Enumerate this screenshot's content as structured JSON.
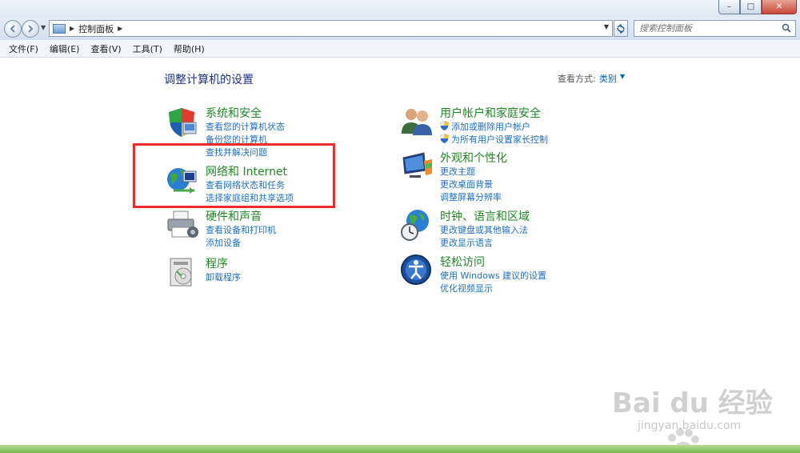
{
  "window": {
    "buttons": {
      "minimize": "–",
      "maximize": "□",
      "close": "✕"
    }
  },
  "address": {
    "path": "控制面板",
    "search_placeholder": "搜索控制面板"
  },
  "menu": [
    "文件(F)",
    "编辑(E)",
    "查看(V)",
    "工具(T)",
    "帮助(H)"
  ],
  "page": {
    "title": "调整计算机的设置",
    "view_by_label": "查看方式:",
    "view_by_value": "类别"
  },
  "categories": [
    {
      "title": "系统和安全",
      "icon": "shield-security-icon",
      "links": [
        "查看您的计算机状态",
        "备份您的计算机",
        "查找并解决问题"
      ]
    },
    {
      "title": "网络和 Internet",
      "icon": "network-globe-icon",
      "links": [
        "查看网络状态和任务",
        "选择家庭组和共享选项"
      ]
    },
    {
      "title": "硬件和声音",
      "icon": "printer-icon",
      "links": [
        "查看设备和打印机",
        "添加设备"
      ]
    },
    {
      "title": "程序",
      "icon": "programs-icon",
      "links": [
        "卸载程序"
      ]
    },
    {
      "title": "用户帐户和家庭安全",
      "icon": "users-icon",
      "links": [
        "添加或删除用户帐户",
        "为所有用户设置家长控制"
      ]
    },
    {
      "title": "外观和个性化",
      "icon": "display-icon",
      "links": [
        "更改主题",
        "更改桌面背景",
        "调整屏幕分辨率"
      ]
    },
    {
      "title": "时钟、语言和区域",
      "icon": "clock-globe-icon",
      "links": [
        "更改键盘或其他输入法",
        "更改显示语言"
      ]
    },
    {
      "title": "轻松访问",
      "icon": "ease-of-access-icon",
      "links": [
        "使用 Windows 建议的设置",
        "优化视频显示"
      ]
    }
  ],
  "watermark": {
    "brand": "Bai du 经验",
    "url": "jingyan.baidu.com"
  },
  "colors": {
    "link": "#1f6fc9",
    "category_title": "#1e8a24",
    "highlight": "#ee2b2b"
  }
}
